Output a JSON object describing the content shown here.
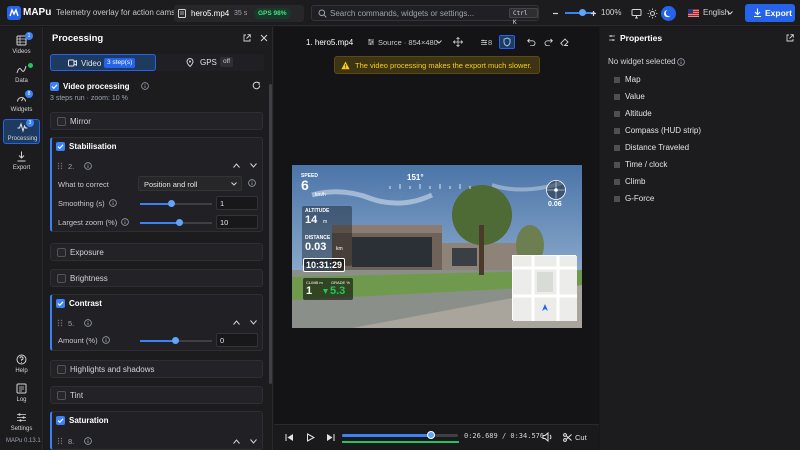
{
  "app": {
    "name": "MAPu",
    "tagline": "Telemetry overlay for action cams",
    "file_name": "hero5.mp4",
    "file_duration": "35 s",
    "gps_badge": "GPS 98%",
    "search_placeholder": "Search commands, widgets or settings...",
    "search_shortcut": "Ctrl K",
    "zoom": "100%",
    "language": "English",
    "export_label": "Export",
    "version": "MAPu 0.13.1"
  },
  "sidebar": {
    "items": [
      {
        "label": "Videos",
        "badge": "1"
      },
      {
        "label": "Data",
        "badge": ""
      },
      {
        "label": "Widgets",
        "badge": "8"
      },
      {
        "label": "Processing",
        "badge": "3"
      },
      {
        "label": "Export",
        "badge": ""
      }
    ],
    "bottom": [
      {
        "label": "Help"
      },
      {
        "label": "Log"
      },
      {
        "label": "Settings"
      }
    ]
  },
  "processing": {
    "title": "Processing",
    "tab_video": "Video",
    "tab_video_badge": "3 step(s)",
    "tab_gps": "GPS",
    "tab_gps_badge": "off",
    "video_processing_label": "Video processing",
    "summary": "3 steps run · zoom: 10 %",
    "mirror": "Mirror",
    "stabilisation": {
      "label": "Stabilisation",
      "index": "2.",
      "what_to_correct_label": "What to correct",
      "what_to_correct_value": "Position and roll",
      "smoothing_label": "Smoothing (s)",
      "smoothing_value": "1",
      "smoothing_level": 0.45,
      "largest_zoom_label": "Largest zoom (%)",
      "largest_zoom_value": "10",
      "largest_zoom_level": 0.55
    },
    "exposure": "Exposure",
    "brightness": "Brightness",
    "contrast": {
      "label": "Contrast",
      "index": "5.",
      "amount_label": "Amount (%)",
      "amount_value": "0",
      "amount_level": 0.5
    },
    "highlights": "Highlights and shadows",
    "tint": "Tint",
    "saturation": {
      "label": "Saturation",
      "index": "8."
    }
  },
  "center": {
    "video_title": "1. hero5.mp4",
    "source_label": "Source · 854×480",
    "widget_count": "8",
    "warning": "The video processing makes the export much slower.",
    "time_current": "0:26.689",
    "time_sep": "/",
    "time_total": "0:34.576",
    "cut_label": "Cut",
    "progress": 0.77
  },
  "overlay": {
    "speed_label": "SPEED",
    "speed_value": "6",
    "speed_unit": "km/h",
    "altitude_label": "ALTITUDE",
    "altitude_value": "14",
    "altitude_unit": "m",
    "distance_label": "DISTANCE",
    "distance_value": "0.03",
    "distance_unit": "km",
    "clock": "10:31:29",
    "climb_label": "CLIMB m",
    "climb_value": "1",
    "grade_label": "GRADE %",
    "grade_value": "5.3",
    "compass_heading": "151°",
    "gforce_value": "0.06"
  },
  "properties": {
    "title": "Properties",
    "no_widget": "No widget selected",
    "widgets": [
      "Map",
      "Value",
      "Altitude",
      "Compass (HUD strip)",
      "Distance Traveled",
      "Time / clock",
      "Climb",
      "G-Force"
    ]
  },
  "colors": {
    "accent": "#2563eb",
    "background": "#18181b",
    "warning": "#facc15",
    "success": "#22c55e"
  }
}
